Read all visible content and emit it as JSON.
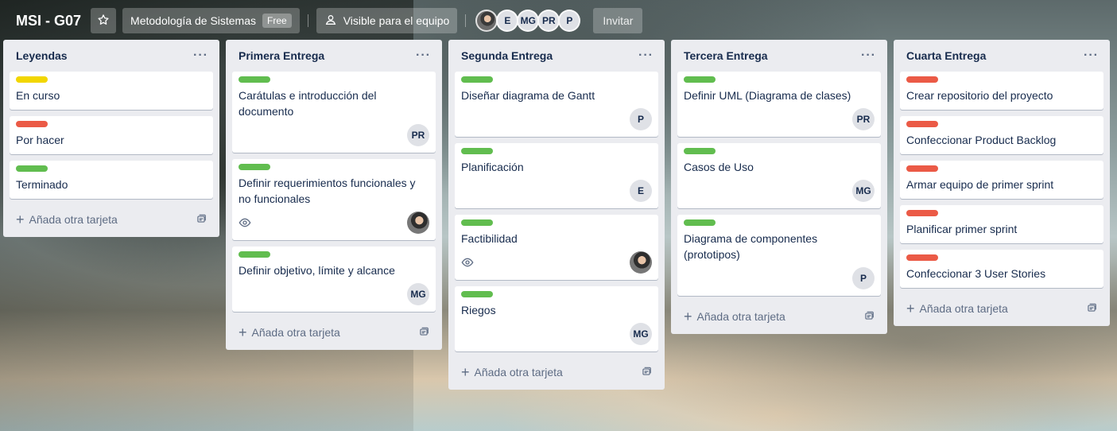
{
  "header": {
    "board_title": "MSI - G07",
    "star_icon": "star-icon",
    "workspace_name": "Metodología de Sistemas",
    "workspace_badge": "Free",
    "visibility_label": "Visible para el equipo",
    "visibility_icon": "team-icon",
    "members": [
      "photo",
      "E",
      "MG",
      "PR",
      "P"
    ],
    "invite_label": "Invitar"
  },
  "lists": [
    {
      "title": "Leyendas",
      "cards": [
        {
          "label": "yellow",
          "title": "En curso",
          "avatar": "",
          "eye": false
        },
        {
          "label": "red",
          "title": "Por hacer",
          "avatar": "",
          "eye": false
        },
        {
          "label": "green",
          "title": "Terminado",
          "avatar": "",
          "eye": false
        }
      ],
      "add_label": "Añada otra tarjeta"
    },
    {
      "title": "Primera Entrega",
      "cards": [
        {
          "label": "green",
          "title": "Carátulas e introducción del documento",
          "avatar": "PR",
          "eye": false
        },
        {
          "label": "green",
          "title": "Definir requerimientos funcionales y no funcionales",
          "avatar": "photo",
          "eye": true
        },
        {
          "label": "green",
          "title": "Definir objetivo, límite y alcance",
          "avatar": "MG",
          "eye": false
        }
      ],
      "add_label": "Añada otra tarjeta"
    },
    {
      "title": "Segunda Entrega",
      "cards": [
        {
          "label": "green",
          "title": "Diseñar diagrama de Gantt",
          "avatar": "P",
          "eye": false
        },
        {
          "label": "green",
          "title": "Planificación",
          "avatar": "E",
          "eye": false
        },
        {
          "label": "green",
          "title": "Factibilidad",
          "avatar": "photo",
          "eye": true
        },
        {
          "label": "green",
          "title": "Riegos",
          "avatar": "MG",
          "eye": false
        }
      ],
      "add_label": "Añada otra tarjeta"
    },
    {
      "title": "Tercera Entrega",
      "cards": [
        {
          "label": "green",
          "title": "Definir UML (Diagrama de clases)",
          "avatar": "PR",
          "eye": false
        },
        {
          "label": "green",
          "title": "Casos de Uso",
          "avatar": "MG",
          "eye": false
        },
        {
          "label": "green",
          "title": "Diagrama de componentes (prototipos)",
          "avatar": "P",
          "eye": false
        }
      ],
      "add_label": "Añada otra tarjeta"
    },
    {
      "title": "Cuarta Entrega",
      "cards": [
        {
          "label": "red",
          "title": "Crear repositorio del proyecto",
          "avatar": "",
          "eye": false
        },
        {
          "label": "red",
          "title": "Confeccionar Product Backlog",
          "avatar": "",
          "eye": false
        },
        {
          "label": "red",
          "title": "Armar equipo de primer sprint",
          "avatar": "",
          "eye": false
        },
        {
          "label": "red",
          "title": "Planificar primer sprint",
          "avatar": "",
          "eye": false
        },
        {
          "label": "red",
          "title": "Confeccionar 3 User Stories",
          "avatar": "",
          "eye": false
        }
      ],
      "add_label": "Añada otra tarjeta"
    }
  ],
  "colors": {
    "label_yellow": "#f2d600",
    "label_red": "#eb5a46",
    "label_green": "#61bd4f",
    "list_bg": "#ebecf0"
  }
}
